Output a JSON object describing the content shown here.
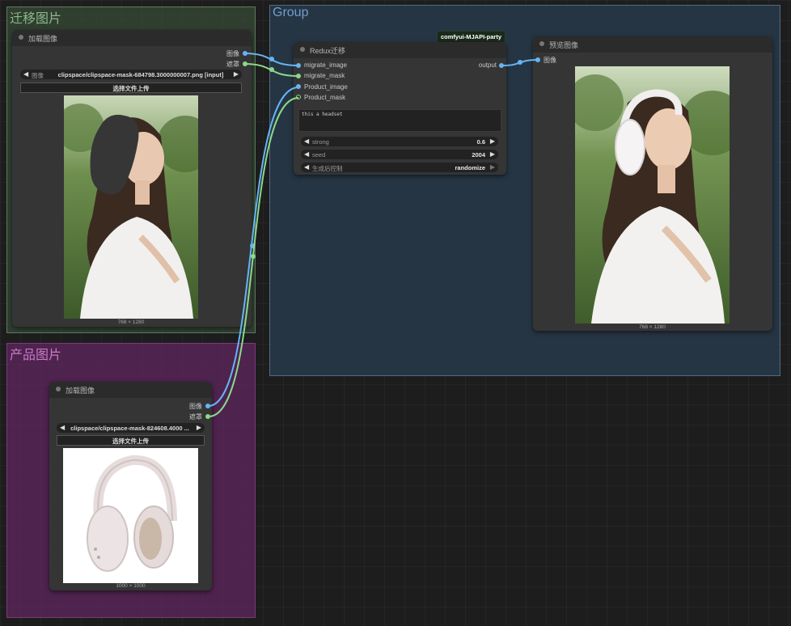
{
  "colors": {
    "group_migrate": "#3f5a3f",
    "group_product": "#5a2a5a",
    "group_main": "#28394a",
    "wire_image": "#64b5f6",
    "wire_mask": "#8bd88b"
  },
  "groups": {
    "migrate": {
      "title": "迁移图片"
    },
    "product": {
      "title": "产品图片"
    },
    "main": {
      "title": "Group"
    }
  },
  "load_node_1": {
    "title": "加载图像",
    "outputs": {
      "image": "图像",
      "mask": "遮罩"
    },
    "widget_label": "图像",
    "filename": "clipspace/clipspace-mask-684798.3000000007.png [input]",
    "upload_label": "选择文件上传",
    "dims": "768 × 1280"
  },
  "load_node_2": {
    "title": "加载图像",
    "outputs": {
      "image": "图像",
      "mask": "遮罩"
    },
    "filename": "clipspace/clipspace-mask-824608.4000 ...",
    "upload_label": "选择文件上传",
    "dims": "1000 × 1000"
  },
  "redux_node": {
    "title": "Redux迁移",
    "badge": "comfyui-MJAPI-party",
    "inputs": [
      "migrate_image",
      "migrate_mask",
      "Product_image",
      "Product_mask"
    ],
    "output": "output",
    "prompt": "this a headset",
    "widgets": {
      "strong": {
        "label": "strong",
        "value": "0.6"
      },
      "seed": {
        "label": "seed",
        "value": "2004"
      },
      "control": {
        "label": "生成后控制",
        "value": "randomize"
      }
    }
  },
  "preview_node": {
    "title": "预览图像",
    "input": "图像",
    "dims": "768 × 1280"
  }
}
